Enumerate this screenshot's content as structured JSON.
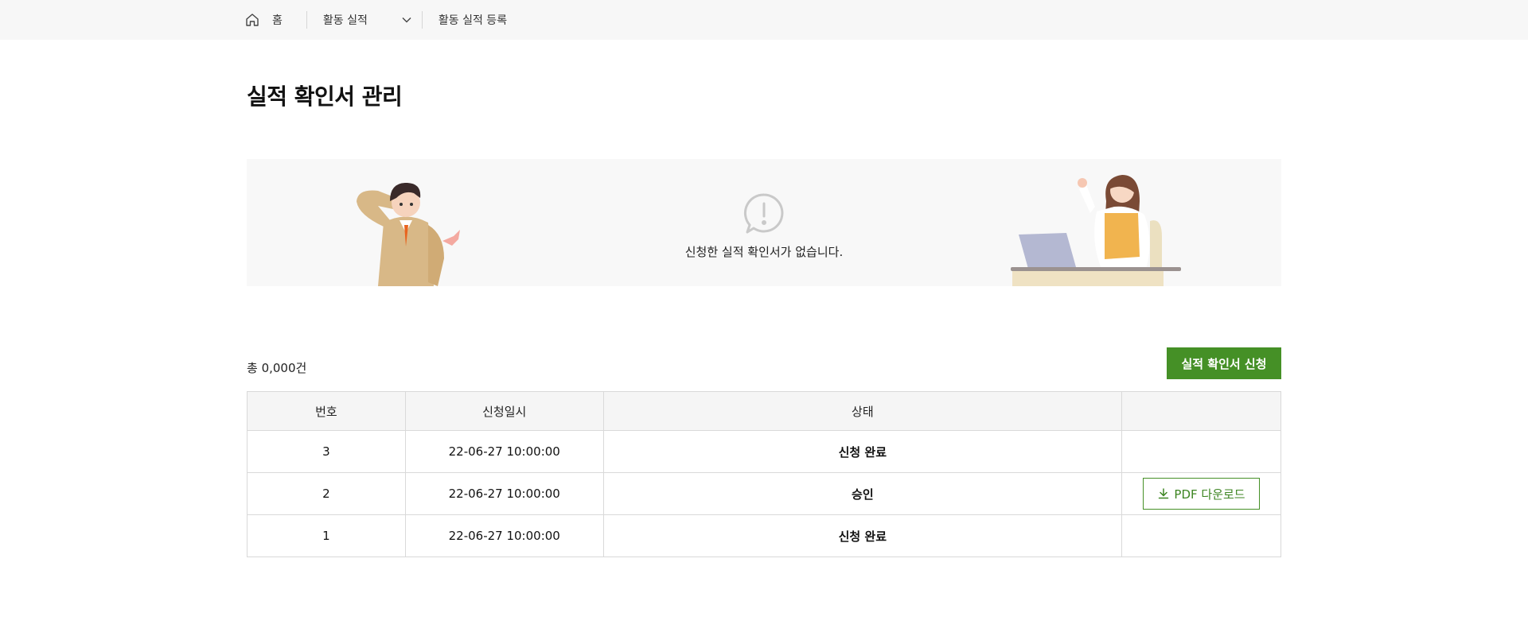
{
  "breadcrumb": {
    "home_label": "홈",
    "section_label": "활동 실적",
    "current_label": "활동 실적 등록"
  },
  "page": {
    "title": "실적 확인서 관리"
  },
  "empty_notice": {
    "message": "신청한 실적 확인서가 없습니다."
  },
  "list": {
    "total_label": "총 0,000건",
    "apply_button_label": "실적 확인서 신청",
    "columns": [
      "번호",
      "신청일시",
      "상태",
      ""
    ],
    "rows": [
      {
        "no": "3",
        "date": "22-06-27 10:00:00",
        "status": "신청 완료",
        "action": ""
      },
      {
        "no": "2",
        "date": "22-06-27 10:00:00",
        "status": "승인",
        "action": "PDF 다운로드"
      },
      {
        "no": "1",
        "date": "22-06-27 10:00:00",
        "status": "신청 완료",
        "action": ""
      }
    ]
  },
  "colors": {
    "accent": "#459026",
    "topbar_bg": "#f7f7f7",
    "banner_bg": "#f8f8f8"
  },
  "icons": [
    "home-icon",
    "chevron-down-icon",
    "exclamation-bubble-icon",
    "download-icon"
  ]
}
